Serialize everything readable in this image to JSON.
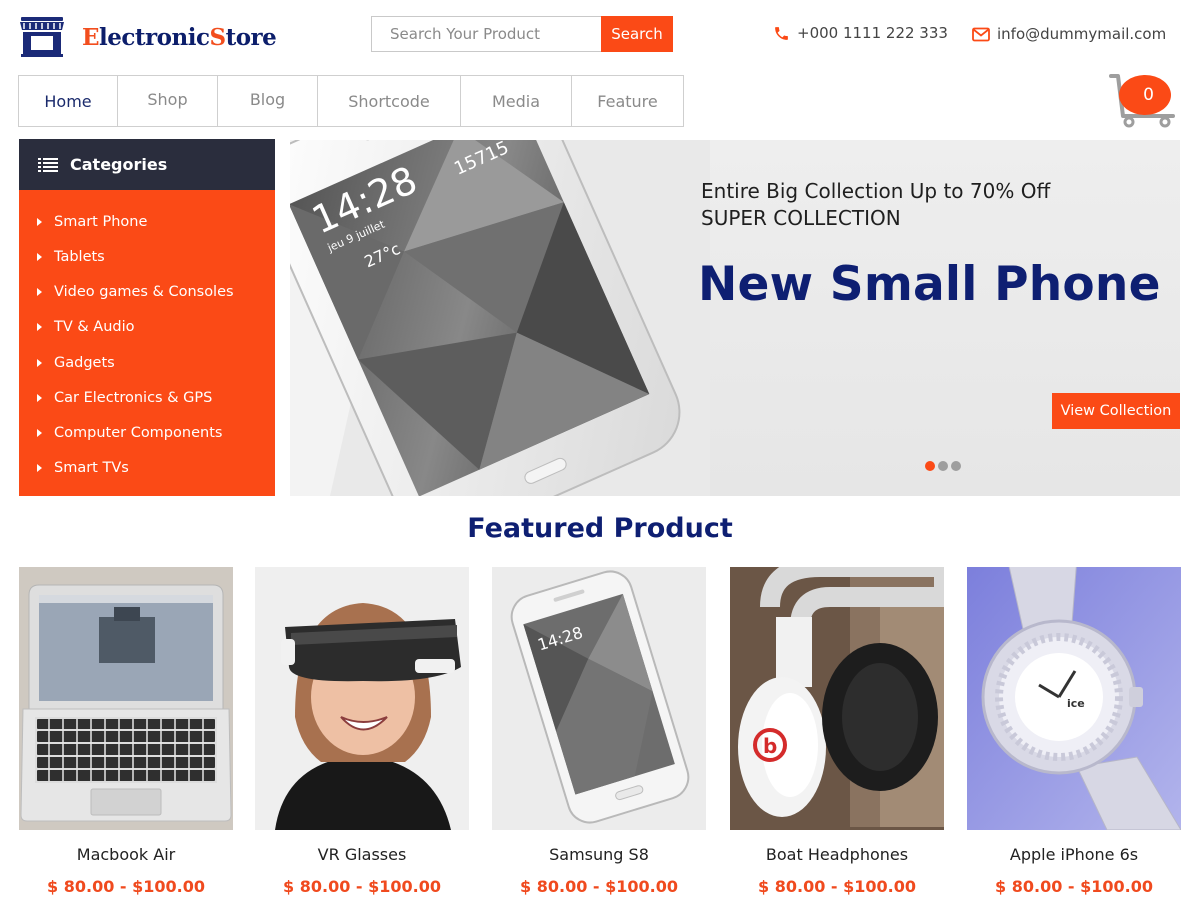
{
  "header": {
    "logo": {
      "first_letter": "E",
      "part1": "lectronic",
      "accent_letter": "S",
      "part2": "tore"
    },
    "search": {
      "placeholder": "Search Your Product",
      "button_label": "Search"
    },
    "phone": "+000 1111 222 333",
    "email": "info@dummymail.com"
  },
  "nav": {
    "items": [
      {
        "label": "Home",
        "active": true
      },
      {
        "label": "Shop"
      },
      {
        "label": "Blog"
      },
      {
        "label": "Shortcode"
      },
      {
        "label": "Media"
      },
      {
        "label": "Feature"
      }
    ]
  },
  "cart": {
    "count": "0"
  },
  "categories": {
    "title": "Categories",
    "items": [
      "Smart Phone",
      "Tablets",
      "Video games & Consoles",
      "TV & Audio",
      "Gadgets",
      "Car Electronics & GPS",
      "Computer Components",
      "Smart TVs"
    ]
  },
  "hero": {
    "subtitle_line1": "Entire Big Collection Up to 70% Off",
    "subtitle_line2": "SUPER COLLECTION",
    "title": "New Small Phone",
    "button_label": "View Collection",
    "phone_screen": {
      "time": "14:28",
      "date": "jeu 9 juillet",
      "temp": "27°c",
      "steps": "15715"
    },
    "slides_total": 3,
    "active_slide": 1
  },
  "featured": {
    "title": "Featured Product",
    "products": [
      {
        "name": "Macbook Air",
        "price": "$ 80.00 - $100.00"
      },
      {
        "name": "VR Glasses",
        "price": "$ 80.00 - $100.00"
      },
      {
        "name": "Samsung S8",
        "price": "$ 80.00 - $100.00"
      },
      {
        "name": "Boat Headphones",
        "price": "$ 80.00 - $100.00"
      },
      {
        "name": "Apple iPhone 6s",
        "price": "$ 80.00 - $100.00"
      }
    ]
  },
  "colors": {
    "accent": "#fb4a16",
    "brand_navy": "#0e1f72",
    "category_header": "#2a2d3d"
  }
}
